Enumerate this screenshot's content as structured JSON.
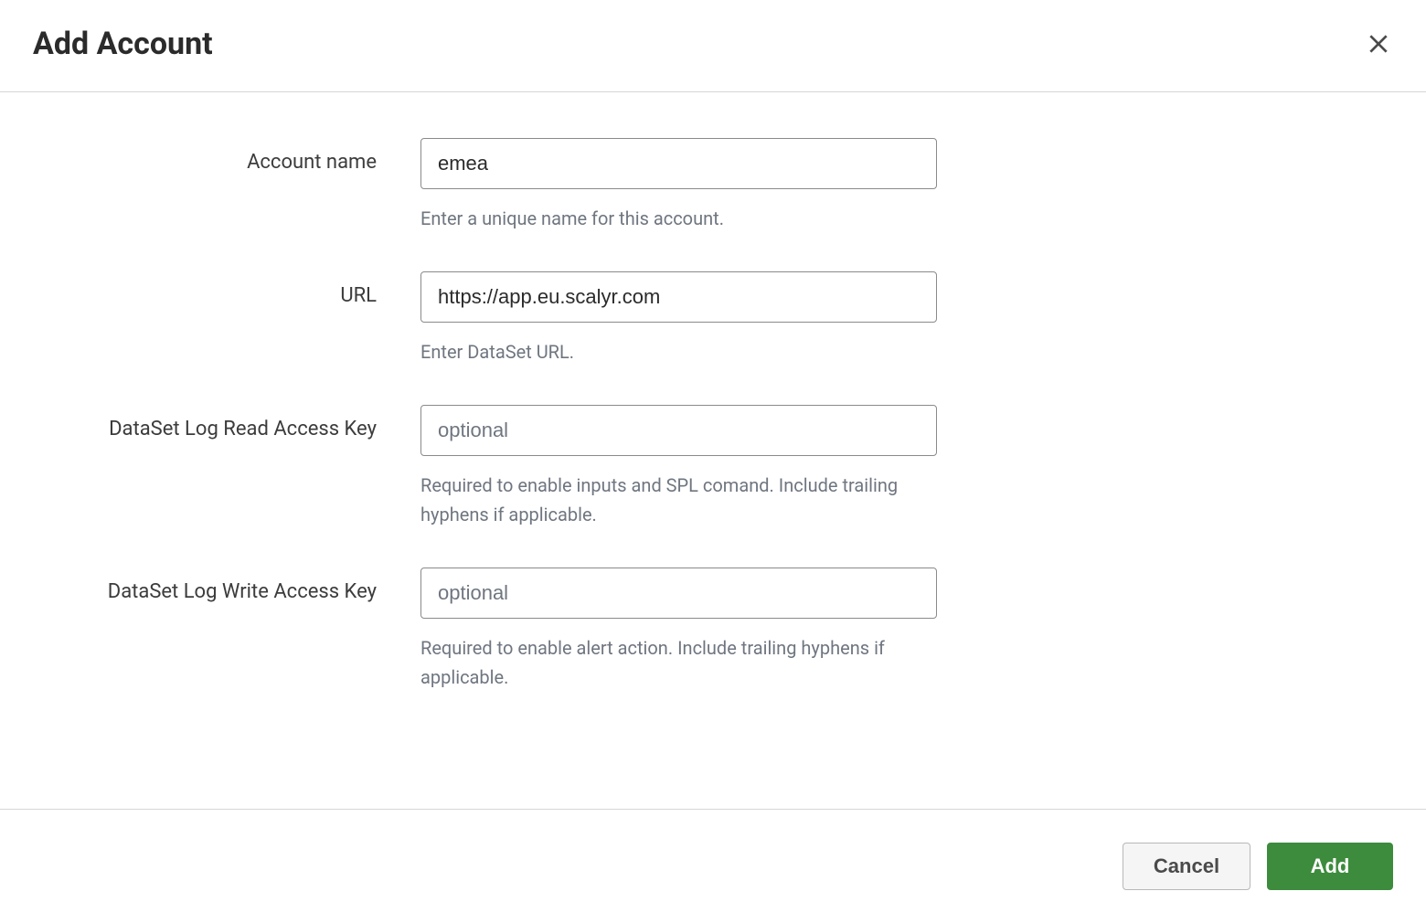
{
  "header": {
    "title": "Add Account"
  },
  "form": {
    "account_name": {
      "label": "Account name",
      "value": "emea",
      "help": "Enter a unique name for this account."
    },
    "url": {
      "label": "URL",
      "value": "https://app.eu.scalyr.com",
      "help": "Enter DataSet URL."
    },
    "read_key": {
      "label": "DataSet Log Read Access Key",
      "value": "",
      "placeholder": "optional",
      "help": "Required to enable inputs and SPL comand. Include trailing hyphens if applicable."
    },
    "write_key": {
      "label": "DataSet Log Write Access Key",
      "value": "",
      "placeholder": "optional",
      "help": "Required to enable alert action. Include trailing hyphens if applicable."
    }
  },
  "footer": {
    "cancel_label": "Cancel",
    "add_label": "Add"
  }
}
